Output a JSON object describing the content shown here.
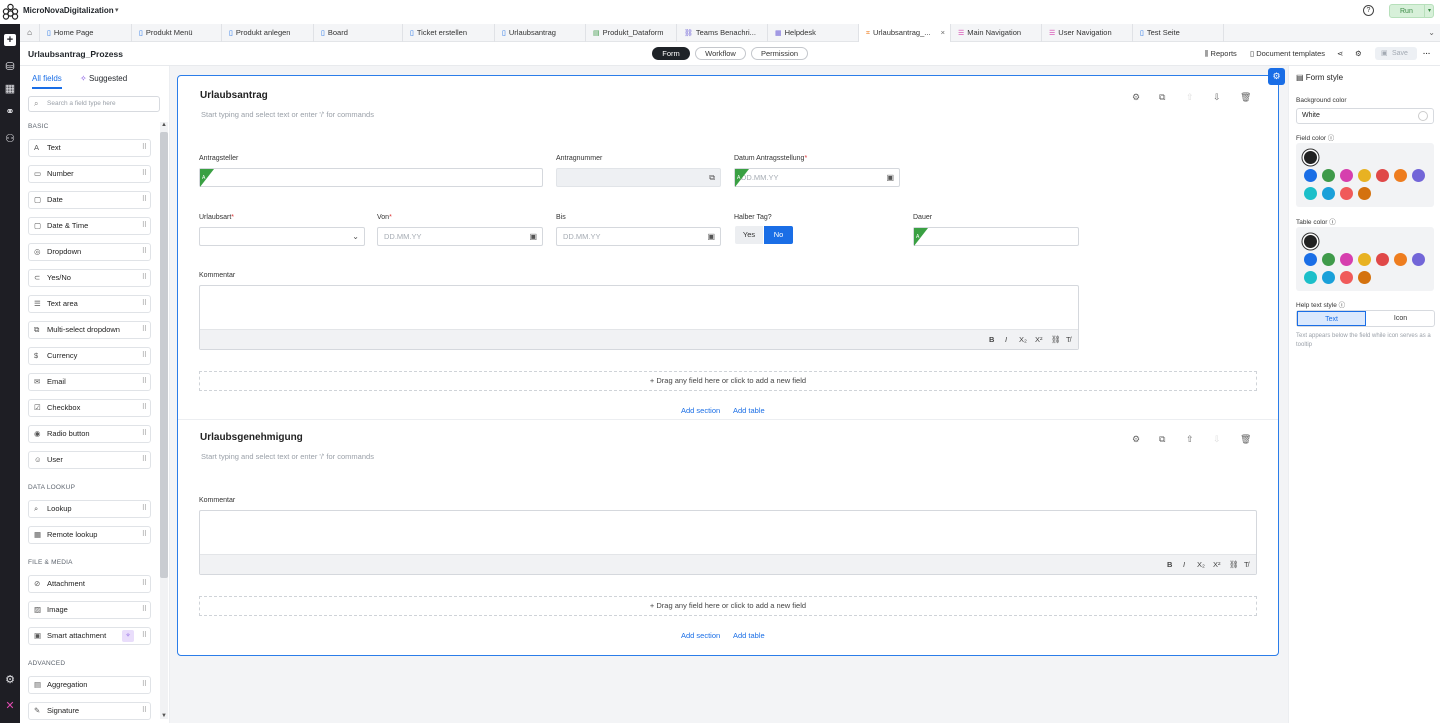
{
  "app": {
    "name": "MicroNovaDigitalization",
    "run_label": "Run",
    "help_glyph": "?"
  },
  "tabs": [
    {
      "label": "Home Page",
      "icon": "page-icon"
    },
    {
      "label": "Produkt Menü",
      "icon": "page-icon"
    },
    {
      "label": "Produkt anlegen",
      "icon": "page-icon"
    },
    {
      "label": "Board",
      "icon": "page-icon"
    },
    {
      "label": "Ticket erstellen",
      "icon": "page-icon"
    },
    {
      "label": "Urlaubsantrag",
      "icon": "page-icon"
    },
    {
      "label": "Produkt_Dataform",
      "icon": "dataform-icon"
    },
    {
      "label": "Teams Benachri...",
      "icon": "link-icon"
    },
    {
      "label": "Helpdesk",
      "icon": "board-icon"
    },
    {
      "label": "Urlaubsantrag_...",
      "icon": "process-icon"
    },
    {
      "label": "Main Navigation",
      "icon": "nav-icon"
    },
    {
      "label": "User Navigation",
      "icon": "nav-icon"
    },
    {
      "label": "Test Seite",
      "icon": "page-icon"
    }
  ],
  "header": {
    "title": "Urlaubsantrag_Prozess",
    "modes": [
      "Form",
      "Workflow",
      "Permission"
    ],
    "active_mode": "Form",
    "reports": "Reports",
    "doc_templates": "Document templates",
    "save": "Save"
  },
  "left": {
    "tabs": {
      "all": "All fields",
      "suggested": "Suggested"
    },
    "search_placeholder": "Search a field type here",
    "groups": {
      "basic": "BASIC",
      "lookup": "DATA LOOKUP",
      "file": "FILE & MEDIA",
      "advanced": "ADVANCED"
    },
    "basic": [
      "Text",
      "Number",
      "Date",
      "Date & Time",
      "Dropdown",
      "Yes/No",
      "Text area",
      "Multi-select dropdown",
      "Currency",
      "Email",
      "Checkbox",
      "Radio button",
      "User"
    ],
    "lookup": [
      "Lookup",
      "Remote lookup"
    ],
    "file": [
      "Attachment",
      "Image",
      "Smart attachment"
    ],
    "advanced": [
      "Aggregation",
      "Signature"
    ]
  },
  "form": {
    "section1": {
      "title": "Urlaubsantrag",
      "help": "Start typing and select text or enter '/' for commands",
      "fields": {
        "antragsteller": "Antragsteller",
        "antragnummer": "Antragnummer",
        "datum": "Datum Antragsstellung",
        "urlaubsart": "Urlaubsart",
        "von": "Von",
        "bis": "Bis",
        "halber": "Halber Tag?",
        "dauer": "Dauer",
        "kommentar": "Kommentar"
      },
      "date_placeholder": "DD.MM.YY",
      "yes": "Yes",
      "no": "No"
    },
    "section2": {
      "title": "Urlaubsgenehmigung",
      "help": "Start typing and select text or enter '/' for commands",
      "kommentar": "Kommentar"
    },
    "drop_hint": "Drag any field here or click to add a new field",
    "add_section": "Add section",
    "add_table": "Add table",
    "required_mark": "*"
  },
  "right": {
    "title": "Form style",
    "bg_label": "Background color",
    "bg_value": "White",
    "field_color": "Field color",
    "table_color": "Table color",
    "help_style": "Help text style",
    "help_text": "Text",
    "help_icon": "Icon",
    "note": "Text appears below the field while icon serves as a tooltip",
    "swatches": [
      "#1a6ee6",
      "#3f9a4a",
      "#d63fae",
      "#e8b222",
      "#e04848",
      "#ee7d1f",
      "#7366d8",
      "#1cbfc9",
      "#1aa0d9",
      "#f05a5a",
      "#d4720f"
    ]
  },
  "rte": [
    "B",
    "I",
    "X₂",
    "X²",
    "🔗",
    "T̸"
  ]
}
